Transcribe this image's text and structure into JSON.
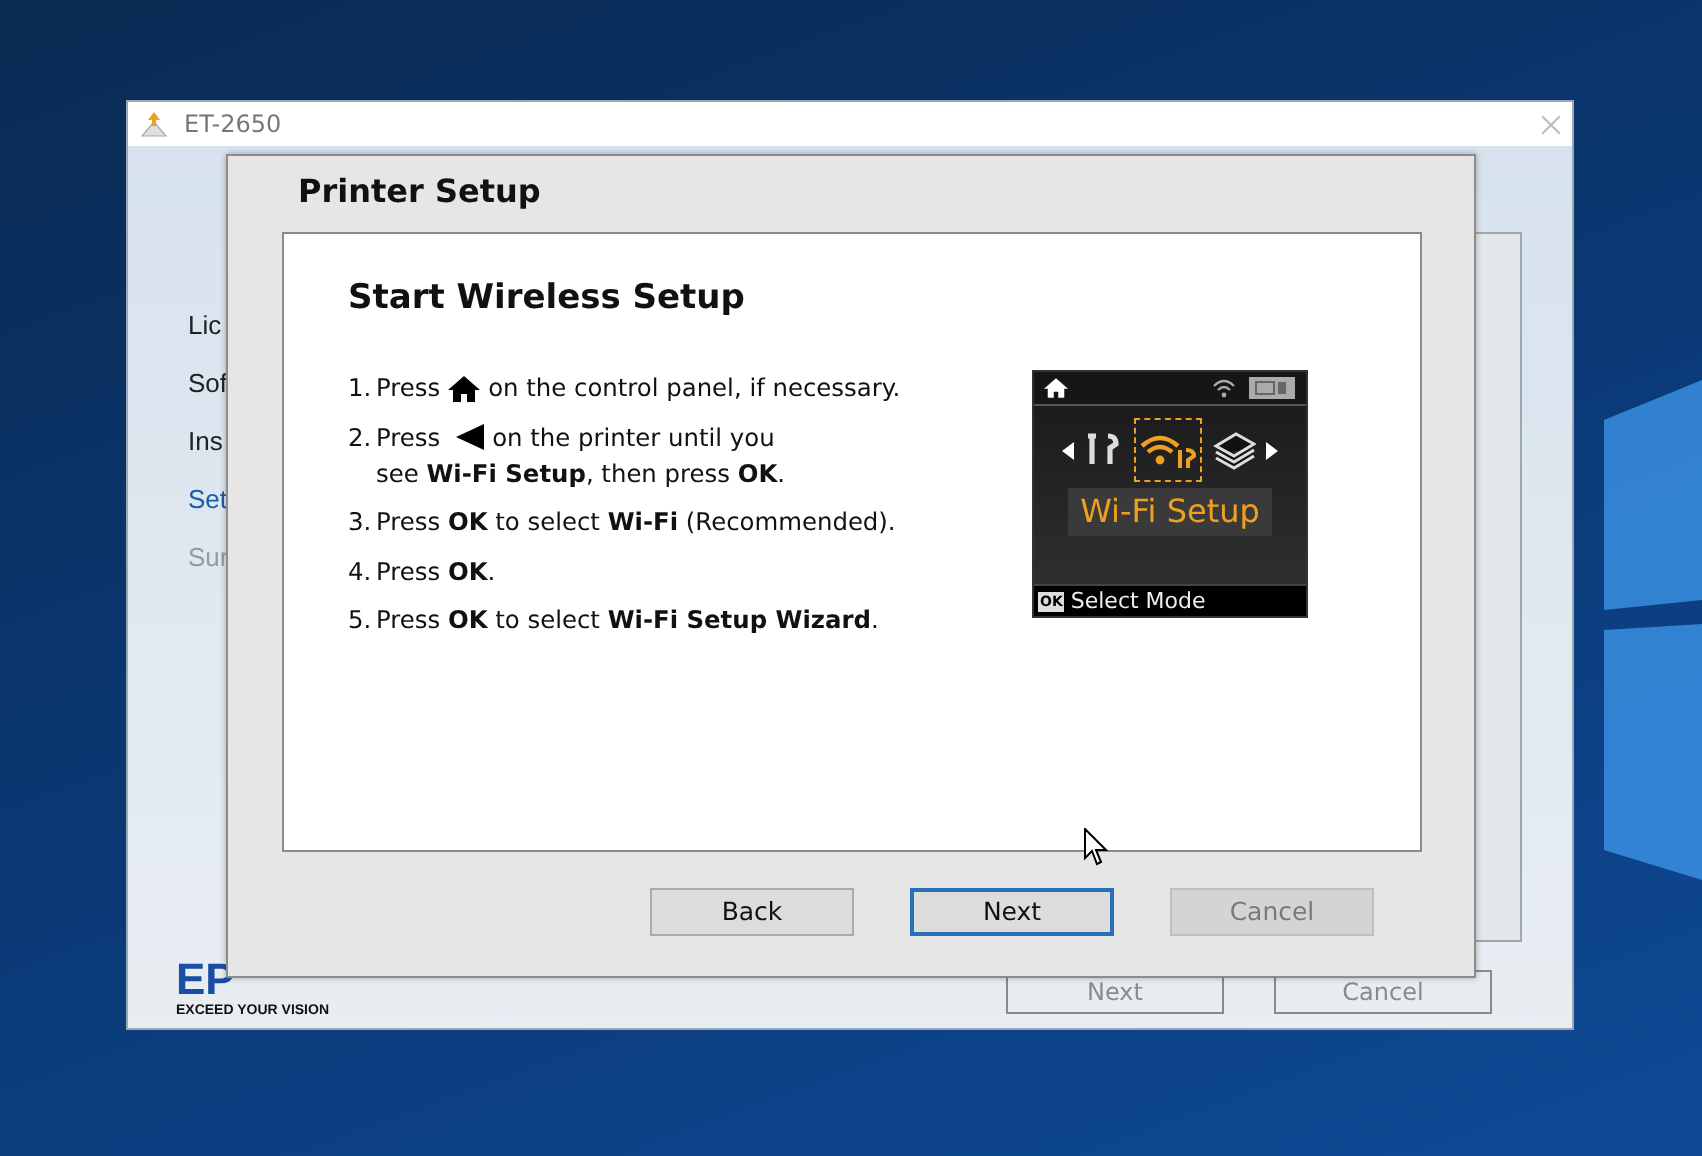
{
  "window": {
    "title": "ET-2650"
  },
  "sidebar": {
    "items": [
      {
        "label": "Lic",
        "selected": false,
        "disabled": false
      },
      {
        "label": "Sof",
        "selected": false,
        "disabled": false
      },
      {
        "label": "Ins",
        "selected": false,
        "disabled": false
      },
      {
        "label": "Set",
        "selected": true,
        "disabled": false
      },
      {
        "label": "Sur",
        "selected": false,
        "disabled": true
      }
    ]
  },
  "logo": {
    "wordmark": "EP",
    "tagline": "EXCEED YOUR VISION"
  },
  "window_buttons": [
    {
      "label": "Next",
      "disabled": true
    },
    {
      "label": "Cancel",
      "disabled": true
    }
  ],
  "dialog": {
    "title": "Printer Setup",
    "heading": "Start Wireless Setup",
    "steps": [
      {
        "number": "1.",
        "lines": [
          [
            {
              "kind": "text",
              "text": "Press"
            },
            {
              "kind": "home"
            },
            {
              "kind": "text",
              "text": "on the control panel, if necessary."
            }
          ]
        ]
      },
      {
        "number": "2.",
        "lines": [
          [
            {
              "kind": "text",
              "text": "Press"
            },
            {
              "kind": "left"
            },
            {
              "kind": "text",
              "text": "on the printer until you"
            }
          ],
          [
            {
              "kind": "text",
              "text": "see **Wi-Fi Setup**, then press **OK**."
            }
          ]
        ]
      },
      {
        "number": "3.",
        "lines": [
          [
            {
              "kind": "text",
              "text": "Press **OK** to select **Wi-Fi** (Recommended)."
            }
          ]
        ]
      },
      {
        "number": "4.",
        "lines": [
          [
            {
              "kind": "text",
              "text": "Press **OK**."
            }
          ]
        ]
      },
      {
        "number": "5.",
        "lines": [
          [
            {
              "kind": "text",
              "text": "Press **OK** to select **Wi-Fi Setup Wizard**."
            }
          ]
        ]
      }
    ],
    "lcd": {
      "modes": [
        {
          "kind": "tools",
          "selected": false
        },
        {
          "kind": "wifi",
          "selected": true
        },
        {
          "kind": "copy",
          "selected": false
        }
      ],
      "label": "Wi-Fi Setup",
      "key": "OK",
      "hint": "Select Mode"
    },
    "buttons": [
      {
        "label": "Back",
        "focused": false,
        "disabled": false
      },
      {
        "label": "Next",
        "focused": true,
        "disabled": false
      },
      {
        "label": "Cancel",
        "focused": false,
        "disabled": true
      }
    ]
  }
}
